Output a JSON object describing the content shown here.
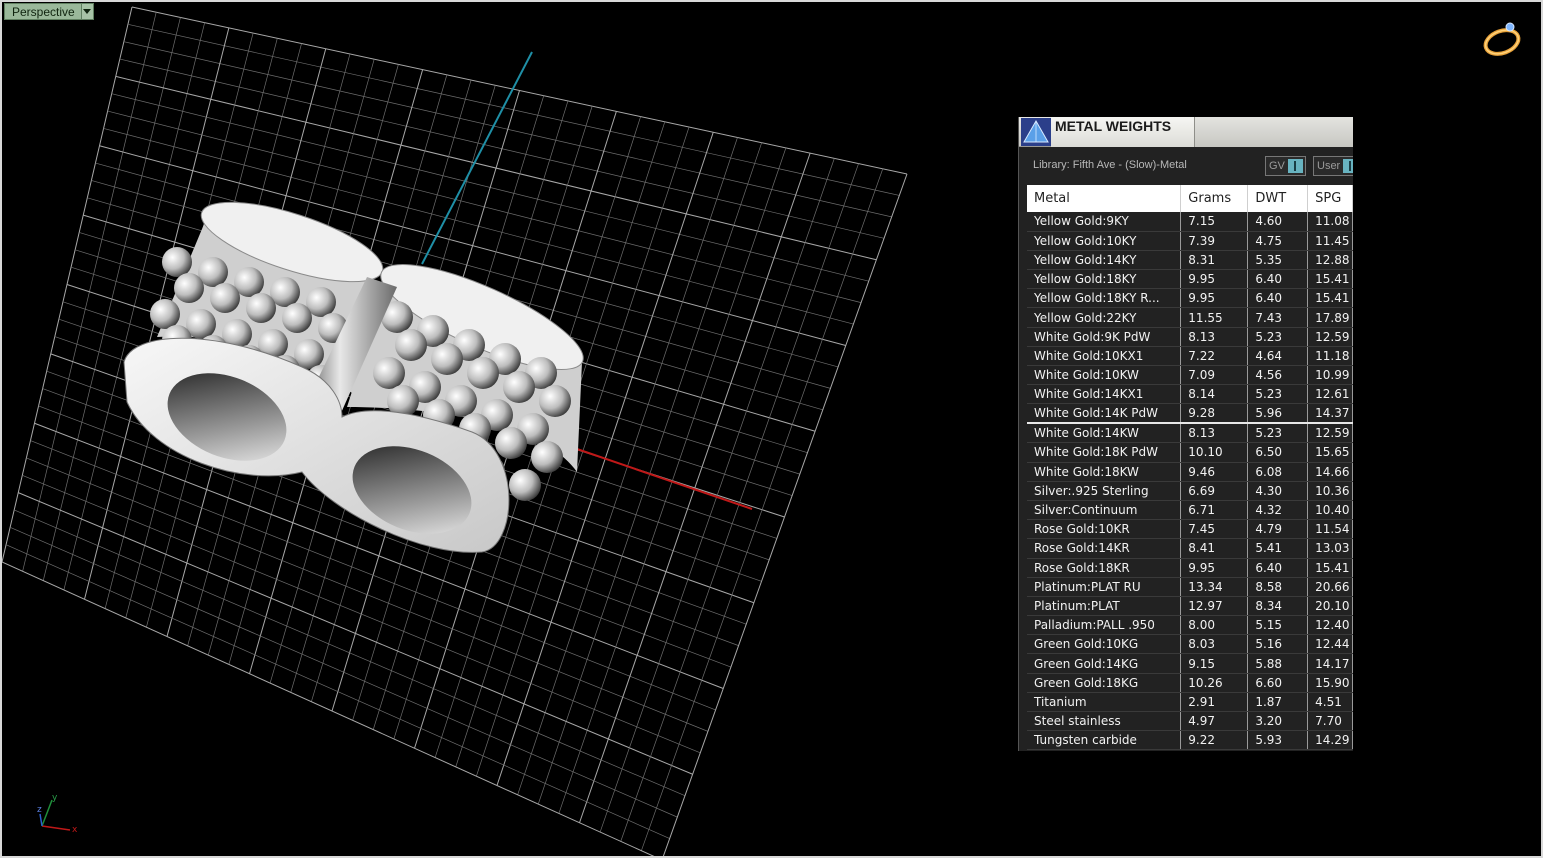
{
  "viewport": {
    "name": "Perspective",
    "axis_labels": {
      "x": "x",
      "y": "y",
      "z": "z"
    }
  },
  "panel": {
    "title": "METAL WEIGHTS",
    "library": "Library: Fifth Ave - (Slow)-Metal",
    "toggle_gv": "GV",
    "toggle_user": "User",
    "columns": [
      "Metal",
      "Grams",
      "DWT",
      "SPG"
    ],
    "rows": [
      {
        "metal": "Yellow Gold:9KY",
        "grams": "7.15",
        "dwt": "4.60",
        "spg": "11.08"
      },
      {
        "metal": "Yellow Gold:10KY",
        "grams": "7.39",
        "dwt": "4.75",
        "spg": "11.45"
      },
      {
        "metal": "Yellow Gold:14KY",
        "grams": "8.31",
        "dwt": "5.35",
        "spg": "12.88"
      },
      {
        "metal": "Yellow Gold:18KY",
        "grams": "9.95",
        "dwt": "6.40",
        "spg": "15.41"
      },
      {
        "metal": "Yellow Gold:18KY R...",
        "grams": "9.95",
        "dwt": "6.40",
        "spg": "15.41"
      },
      {
        "metal": "Yellow Gold:22KY",
        "grams": "11.55",
        "dwt": "7.43",
        "spg": "17.89"
      },
      {
        "metal": "White Gold:9K PdW",
        "grams": "8.13",
        "dwt": "5.23",
        "spg": "12.59"
      },
      {
        "metal": "White Gold:10KX1",
        "grams": "7.22",
        "dwt": "4.64",
        "spg": "11.18"
      },
      {
        "metal": "White Gold:10KW",
        "grams": "7.09",
        "dwt": "4.56",
        "spg": "10.99"
      },
      {
        "metal": "White Gold:14KX1",
        "grams": "8.14",
        "dwt": "5.23",
        "spg": "12.61"
      },
      {
        "metal": "White Gold:14K PdW",
        "grams": "9.28",
        "dwt": "5.96",
        "spg": "14.37"
      },
      {
        "metal": "White Gold:14KW",
        "grams": "8.13",
        "dwt": "5.23",
        "spg": "12.59"
      },
      {
        "metal": "White Gold:18K PdW",
        "grams": "10.10",
        "dwt": "6.50",
        "spg": "15.65"
      },
      {
        "metal": "White Gold:18KW",
        "grams": "9.46",
        "dwt": "6.08",
        "spg": "14.66"
      },
      {
        "metal": "Silver:.925 Sterling",
        "grams": "6.69",
        "dwt": "4.30",
        "spg": "10.36"
      },
      {
        "metal": "Silver:Continuum",
        "grams": "6.71",
        "dwt": "4.32",
        "spg": "10.40"
      },
      {
        "metal": "Rose Gold:10KR",
        "grams": "7.45",
        "dwt": "4.79",
        "spg": "11.54"
      },
      {
        "metal": "Rose Gold:14KR",
        "grams": "8.41",
        "dwt": "5.41",
        "spg": "13.03"
      },
      {
        "metal": "Rose Gold:18KR",
        "grams": "9.95",
        "dwt": "6.40",
        "spg": "15.41"
      },
      {
        "metal": "Platinum:PLAT RU",
        "grams": "13.34",
        "dwt": "8.58",
        "spg": "20.66"
      },
      {
        "metal": "Platinum:PLAT",
        "grams": "12.97",
        "dwt": "8.34",
        "spg": "20.10"
      },
      {
        "metal": "Palladium:PALL .950",
        "grams": "8.00",
        "dwt": "5.15",
        "spg": "12.40"
      },
      {
        "metal": "Green Gold:10KG",
        "grams": "8.03",
        "dwt": "5.16",
        "spg": "12.44"
      },
      {
        "metal": "Green Gold:14KG",
        "grams": "9.15",
        "dwt": "5.88",
        "spg": "14.17"
      },
      {
        "metal": "Green Gold:18KG",
        "grams": "10.26",
        "dwt": "6.60",
        "spg": "15.90"
      },
      {
        "metal": "Titanium",
        "grams": "2.91",
        "dwt": "1.87",
        "spg": "4.51"
      },
      {
        "metal": "Steel stainless",
        "grams": "4.97",
        "dwt": "3.20",
        "spg": "7.70"
      },
      {
        "metal": "Tungsten carbide",
        "grams": "9.22",
        "dwt": "5.93",
        "spg": "14.29"
      }
    ]
  },
  "colors": {
    "background": "#000000",
    "grid": "#8a8a8a",
    "x_axis": "#c01818",
    "y_axis": "#1f8fa6",
    "tab_green": "#9ab89a"
  },
  "icons": {
    "ring_widget": "ring-icon",
    "panel_logo": "pyramid-logo-icon",
    "axis_gizmo": "axis-gizmo-icon"
  }
}
